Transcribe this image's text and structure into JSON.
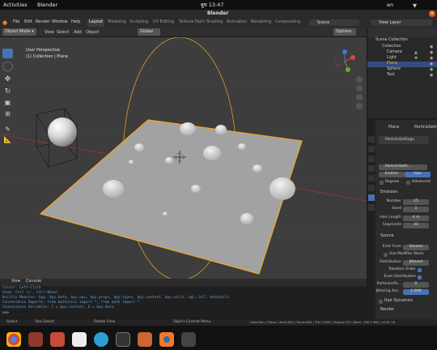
{
  "system": {
    "activities": "Activities",
    "app_name": "Blender",
    "clock": "बुध 13:47",
    "lang": "en"
  },
  "window": {
    "title": "Blender"
  },
  "menu": {
    "items": [
      "File",
      "Edit",
      "Render",
      "Window",
      "Help"
    ],
    "workspaces": [
      "Layout",
      "Modeling",
      "Sculpting",
      "UV Editing",
      "Texture Paint",
      "Shading",
      "Animation",
      "Rendering",
      "Compositing"
    ],
    "scene": "Scene",
    "view_layer": "View Layer"
  },
  "viewport": {
    "mode": "Object Mode",
    "menus": [
      "View",
      "Select",
      "Add",
      "Object"
    ],
    "transform": "Global",
    "options": "Options",
    "perspective": "User Perspective",
    "collection_label": "(1) Collection | Plane"
  },
  "outliner": {
    "root": "Scene Collection",
    "items": [
      {
        "name": "Collection",
        "active": false
      },
      {
        "name": "Camera",
        "active": false
      },
      {
        "name": "Light",
        "active": false
      },
      {
        "name": "Plane",
        "active": true
      },
      {
        "name": "Sphere",
        "active": false
      },
      {
        "name": "Text",
        "active": false
      }
    ]
  },
  "properties": {
    "object": "Plane",
    "particle_settings_tab": "ParticleSett",
    "particle_system": "ParticleSettings",
    "particle_settings_field": "ParticleSetti...",
    "type_options": [
      "Emitter",
      "Hair"
    ],
    "type_selected": "Hair",
    "regrow": "Regrow",
    "advanced": "Advanced",
    "emission_header": "Emission",
    "number_label": "Number",
    "number_value": "15",
    "seed_label": "Seed",
    "seed_value": "1",
    "hair_length_label": "Hair Length",
    "hair_length_value": "4 m",
    "segments_label": "Segments",
    "segments_value": "32",
    "source_header": "Source",
    "emit_from_label": "Emit From",
    "emit_from_value": "Volume",
    "use_modifier_stack": "Use Modifier Stack",
    "distribution_label": "Distribution",
    "distribution_value": "Jittered",
    "random_order": "Random Order",
    "even_distribution": "Even Distribution",
    "particles_face_label": "Particles/Fa...",
    "particles_face_value": "0",
    "jittering_label": "Jittering Am...",
    "jittering_value": "1.000",
    "hair_dynamics": "Hair Dynamics",
    "render_header": "Render"
  },
  "console": {
    "tabs": [
      "View",
      "Console"
    ],
    "lines": [
      "Cursor:         Left-Click",
      "Zoom:           Ctrl +/-, Ctrl-Wheel",
      "Builtin Modules:    bpy, bpy.data, bpy.ops, bpy.props, bpy.types, bpy.context, bpy.utils, bgl, blf, mathutils",
      "Convenience Imports:  from mathutils import *; from math import *",
      "Convenience Variables: C = bpy.context, D = bpy.data",
      ">>>"
    ]
  },
  "statusbar": {
    "select": "Select",
    "box_select": "Box Select",
    "rotate_view": "Rotate View",
    "context_menu": "Object Context Menu",
    "stats": "Collection | Plane | Verts:840 | Faces:804 | Tris:1,538 | Objects:1/5 | Mem: 158.3 MiB | v2.81.16"
  },
  "colors": {
    "accent": "#4772b3",
    "selection": "#f5a623",
    "dock_bg": "#111111"
  }
}
